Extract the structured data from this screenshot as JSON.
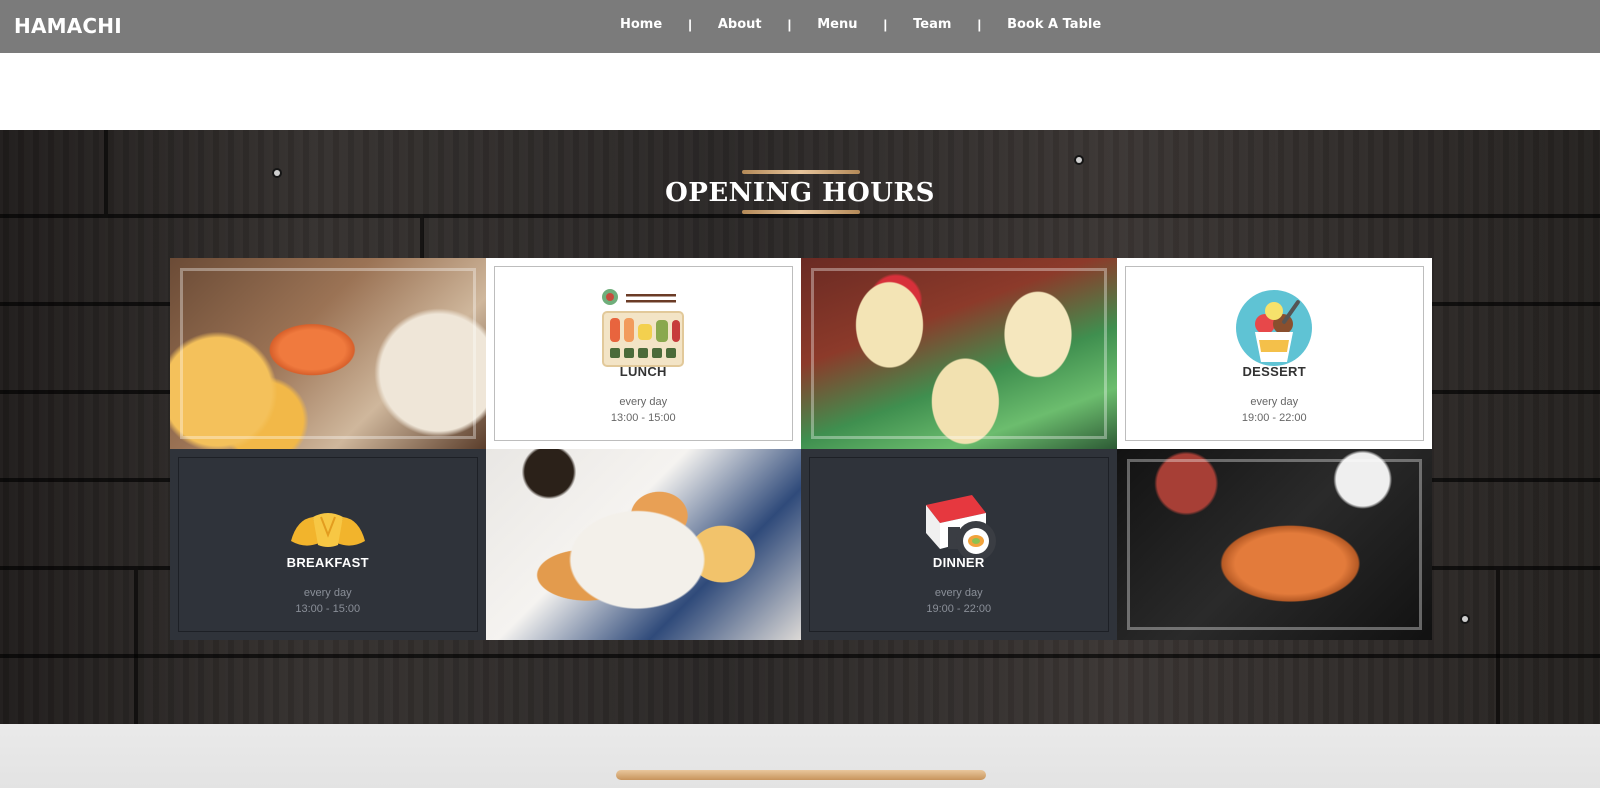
{
  "brand": "HAMACHI",
  "nav": {
    "items": [
      "Home",
      "About",
      "Menu",
      "Team",
      "Book A Table"
    ],
    "separator": "|"
  },
  "section": {
    "title": "OPENING HOURS"
  },
  "cards": {
    "lunch": {
      "title": "LUNCH",
      "days": "every day",
      "time": "13:00 - 15:00"
    },
    "dessert": {
      "title": "DESSERT",
      "days": "every day",
      "time": "19:00 - 22:00"
    },
    "breakfast": {
      "title": "BREAKFAST",
      "days": "every day",
      "time": "13:00 - 15:00"
    },
    "dinner": {
      "title": "DINNER",
      "days": "every day",
      "time": "19:00 - 22:00"
    }
  },
  "icons": [
    "sushi-set-icon",
    "ice-cream-icon",
    "croissant-icon",
    "sushi-roll-icon"
  ],
  "colors": {
    "navbar": "#7b7b7b",
    "dark_card": "#2f333a",
    "accent": "#d8b589"
  }
}
